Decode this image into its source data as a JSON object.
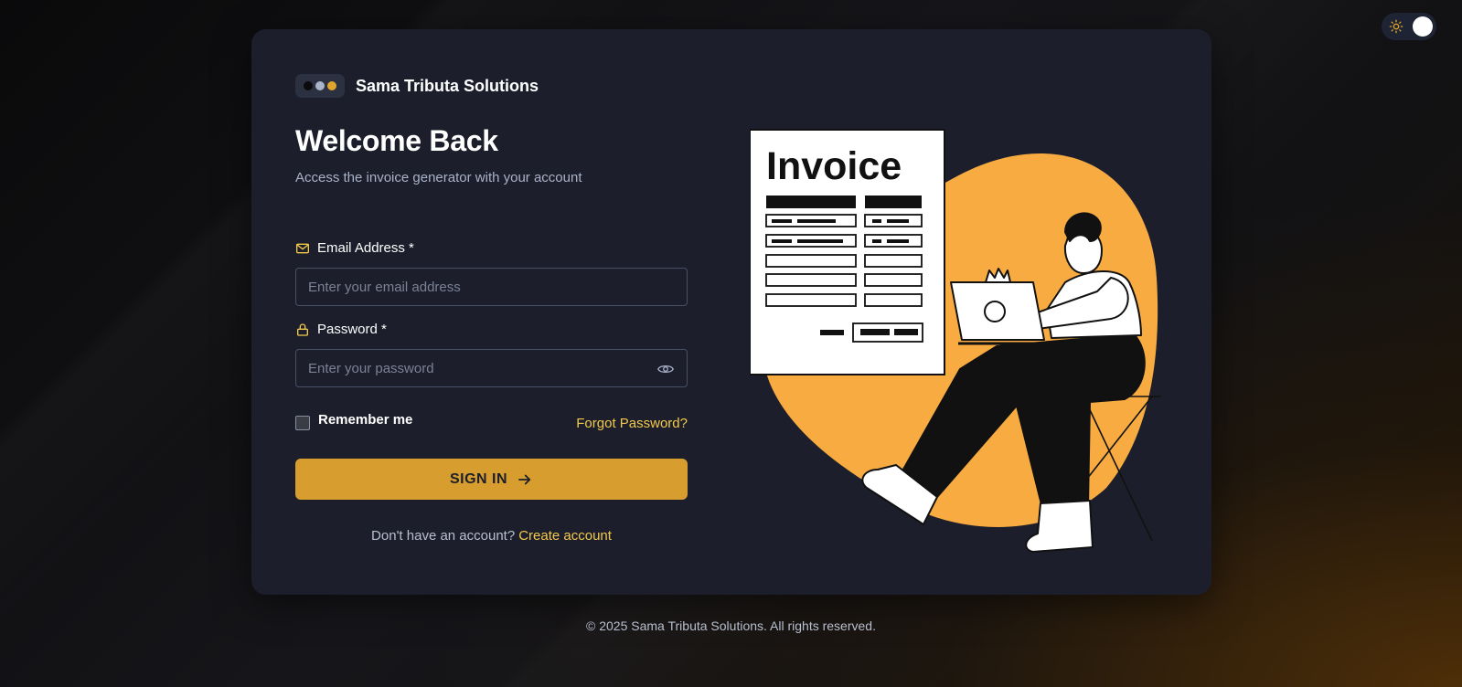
{
  "theme_toggle": {
    "icon": "sun-icon",
    "state": "dark"
  },
  "brand": {
    "name": "Sama Tributa Solutions",
    "dot_colors": [
      "#0b0b0d",
      "#aab4c8",
      "#e0a52c"
    ]
  },
  "header": {
    "title": "Welcome Back",
    "subtitle": "Access the invoice generator with your account"
  },
  "form": {
    "email": {
      "label": "Email Address *",
      "icon": "mail-icon",
      "placeholder": "Enter your email address",
      "value": ""
    },
    "password": {
      "label": "Password *",
      "icon": "lock-icon",
      "placeholder": "Enter your password",
      "value": "",
      "toggle_icon": "eye-icon"
    },
    "remember_label": "Remember me",
    "remember_checked": false,
    "forgot_label": "Forgot Password?",
    "submit_label": "SIGN IN",
    "submit_icon": "arrow-right-icon"
  },
  "signup": {
    "question": "Don't have an account?",
    "link_label": "Create account"
  },
  "illustration": {
    "heading": "Invoice"
  },
  "footer": {
    "copyright": "© 2025 Sama Tributa Solutions. All rights reserved."
  },
  "colors": {
    "accent": "#d79d2f",
    "link": "#f2c94c",
    "card_bg": "#1c1f2b",
    "blob": "#f7ab40"
  }
}
